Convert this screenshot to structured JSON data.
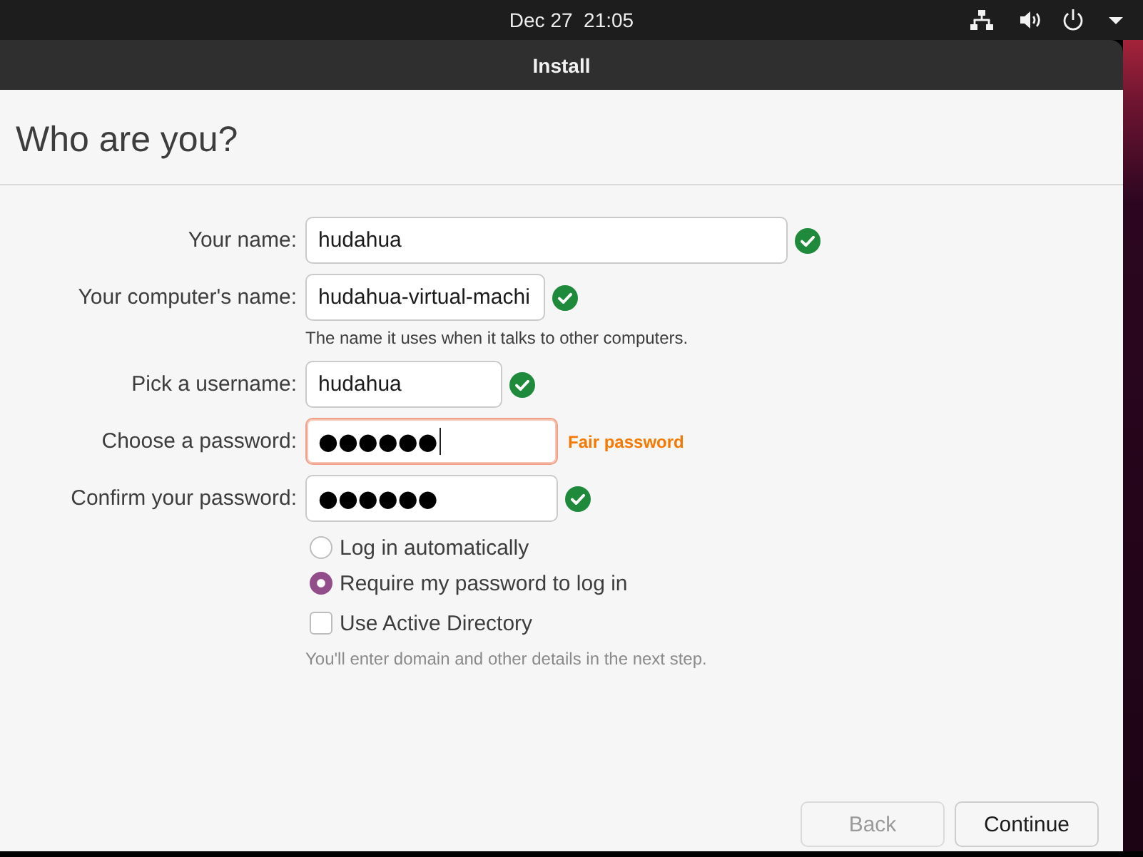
{
  "top_bar": {
    "clock": "Dec 27  21:05"
  },
  "window": {
    "title": "Install"
  },
  "page": {
    "heading": "Who are you?"
  },
  "fields": [
    {
      "kind": "name",
      "label": "Your name:",
      "value": "hudahua",
      "valid": true,
      "focused": false
    },
    {
      "kind": "hostname",
      "label": "Your computer's name:",
      "value": "hudahua-virtual-machi",
      "valid": true,
      "focused": false,
      "hint": "The name it uses when it talks to other computers."
    },
    {
      "kind": "username",
      "label": "Pick a username:",
      "value": "hudahua",
      "valid": true,
      "focused": false
    },
    {
      "kind": "password",
      "label": "Choose a password:",
      "value": "●●●●●●",
      "valid": false,
      "focused": true,
      "strength": "Fair password"
    },
    {
      "kind": "password",
      "label": "Confirm your password:",
      "value": "●●●●●●",
      "valid": true,
      "focused": false
    }
  ],
  "login_options": [
    {
      "label": "Log in automatically",
      "selected": false
    },
    {
      "label": "Require my password to log in",
      "selected": true
    }
  ],
  "active_directory": {
    "label": "Use Active Directory",
    "checked": false,
    "hint": "You'll enter domain and other details in the next step."
  },
  "buttons": [
    {
      "label": "Back",
      "disabled": true
    },
    {
      "label": "Continue",
      "disabled": false
    }
  ]
}
